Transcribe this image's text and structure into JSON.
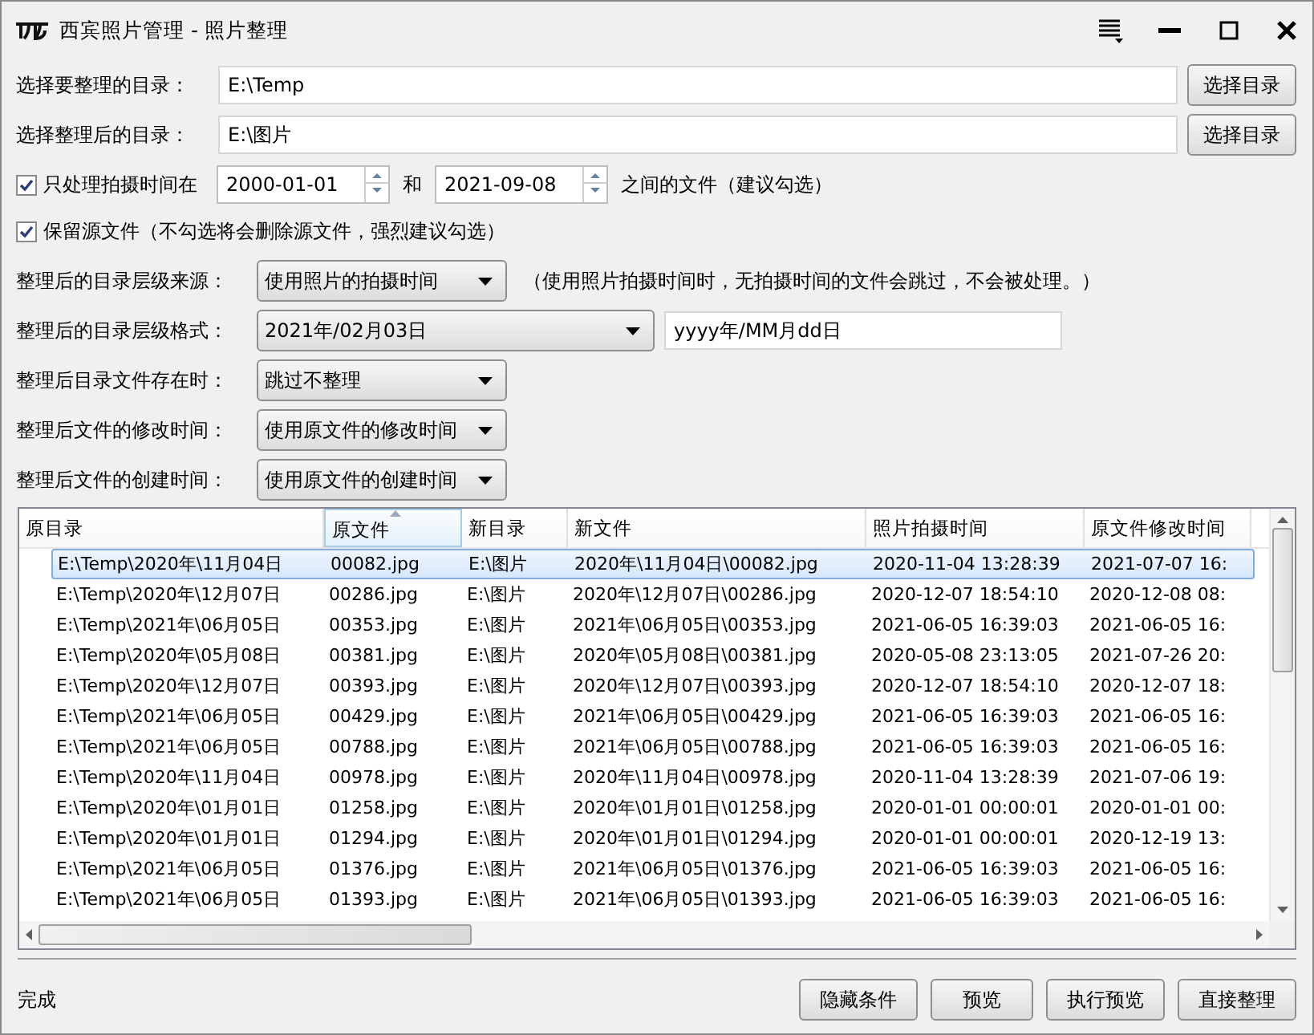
{
  "window": {
    "title": "西宾照片管理 - 照片整理"
  },
  "dir_rows": [
    {
      "label": "选择要整理的目录：",
      "value": "E:\\Temp",
      "button": "选择目录"
    },
    {
      "label": "选择整理后的目录：",
      "value": "E:\\图片",
      "button": "选择目录"
    }
  ],
  "date_filter": {
    "checked": true,
    "label": "只处理拍摄时间在",
    "from": "2000-01-01",
    "joiner": "和",
    "to": "2021-09-08",
    "suffix": "之间的文件（建议勾选）"
  },
  "keep_source": {
    "checked": true,
    "label": "保留源文件（不勾选将会删除源文件，强烈建议勾选）"
  },
  "options": [
    {
      "label": "整理后的目录层级来源：",
      "value": "使用照片的拍摄时间",
      "note": "（使用照片拍摄时间时，无拍摄时间的文件会跳过，不会被处理。）"
    },
    {
      "label": "整理后的目录层级格式：",
      "value": "2021年/02月03日",
      "format": "yyyy年/MM月dd日"
    },
    {
      "label": "整理后目录文件存在时：",
      "value": "跳过不整理"
    },
    {
      "label": "整理后文件的修改时间：",
      "value": "使用原文件的修改时间"
    },
    {
      "label": "整理后文件的创建时间：",
      "value": "使用原文件的创建时间"
    }
  ],
  "table": {
    "columns": [
      {
        "label": "原目录",
        "sorted": false
      },
      {
        "label": "原文件",
        "sorted": true
      },
      {
        "label": "新目录",
        "sorted": false
      },
      {
        "label": "新文件",
        "sorted": false
      },
      {
        "label": "照片拍摄时间",
        "sorted": false
      },
      {
        "label": "原文件修改时间",
        "sorted": false
      }
    ],
    "rows": [
      {
        "selected": true,
        "cells": [
          "E:\\Temp\\2020年\\11月04日",
          "00082.jpg",
          "E:\\图片",
          "2020年\\11月04日\\00082.jpg",
          "2020-11-04 13:28:39",
          "2021-07-07 16:"
        ]
      },
      {
        "selected": false,
        "cells": [
          "E:\\Temp\\2020年\\12月07日",
          "00286.jpg",
          "E:\\图片",
          "2020年\\12月07日\\00286.jpg",
          "2020-12-07 18:54:10",
          "2020-12-08 08:"
        ]
      },
      {
        "selected": false,
        "cells": [
          "E:\\Temp\\2021年\\06月05日",
          "00353.jpg",
          "E:\\图片",
          "2021年\\06月05日\\00353.jpg",
          "2021-06-05 16:39:03",
          "2021-06-05 16:"
        ]
      },
      {
        "selected": false,
        "cells": [
          "E:\\Temp\\2020年\\05月08日",
          "00381.jpg",
          "E:\\图片",
          "2020年\\05月08日\\00381.jpg",
          "2020-05-08 23:13:05",
          "2021-07-26 20:"
        ]
      },
      {
        "selected": false,
        "cells": [
          "E:\\Temp\\2020年\\12月07日",
          "00393.jpg",
          "E:\\图片",
          "2020年\\12月07日\\00393.jpg",
          "2020-12-07 18:54:10",
          "2020-12-07 18:"
        ]
      },
      {
        "selected": false,
        "cells": [
          "E:\\Temp\\2021年\\06月05日",
          "00429.jpg",
          "E:\\图片",
          "2021年\\06月05日\\00429.jpg",
          "2021-06-05 16:39:03",
          "2021-06-05 16:"
        ]
      },
      {
        "selected": false,
        "cells": [
          "E:\\Temp\\2021年\\06月05日",
          "00788.jpg",
          "E:\\图片",
          "2021年\\06月05日\\00788.jpg",
          "2021-06-05 16:39:03",
          "2021-06-05 16:"
        ]
      },
      {
        "selected": false,
        "cells": [
          "E:\\Temp\\2020年\\11月04日",
          "00978.jpg",
          "E:\\图片",
          "2020年\\11月04日\\00978.jpg",
          "2020-11-04 13:28:39",
          "2021-07-06 19:"
        ]
      },
      {
        "selected": false,
        "cells": [
          "E:\\Temp\\2020年\\01月01日",
          "01258.jpg",
          "E:\\图片",
          "2020年\\01月01日\\01258.jpg",
          "2020-01-01 00:00:01",
          "2020-01-01 00:"
        ]
      },
      {
        "selected": false,
        "cells": [
          "E:\\Temp\\2020年\\01月01日",
          "01294.jpg",
          "E:\\图片",
          "2020年\\01月01日\\01294.jpg",
          "2020-01-01 00:00:01",
          "2020-12-19 13:"
        ]
      },
      {
        "selected": false,
        "cells": [
          "E:\\Temp\\2021年\\06月05日",
          "01376.jpg",
          "E:\\图片",
          "2021年\\06月05日\\01376.jpg",
          "2021-06-05 16:39:03",
          "2021-06-05 16:"
        ]
      },
      {
        "selected": false,
        "cells": [
          "E:\\Temp\\2021年\\06月05日",
          "01393.jpg",
          "E:\\图片",
          "2021年\\06月05日\\01393.jpg",
          "2021-06-05 16:39:03",
          "2021-06-05 16:"
        ]
      }
    ]
  },
  "status": "完成",
  "buttons": [
    "隐藏条件",
    "预览",
    "执行预览",
    "直接整理"
  ]
}
